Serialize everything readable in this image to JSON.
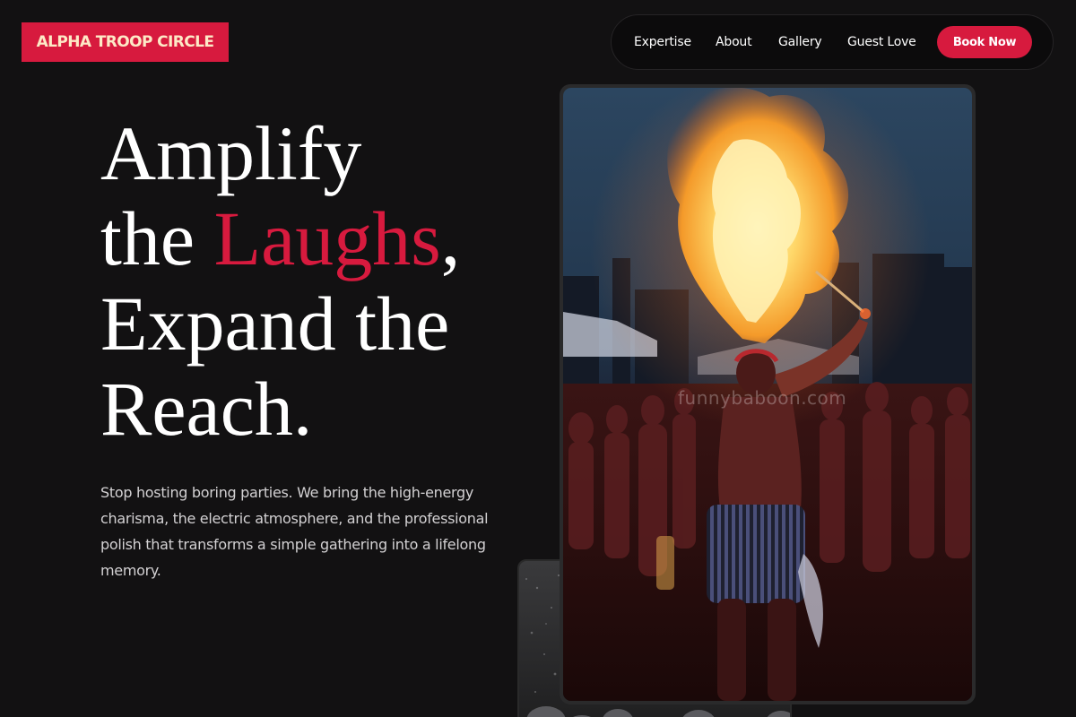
{
  "brand": {
    "logo_text": "ALPHA TROOP CIRCLE"
  },
  "nav": {
    "links": [
      {
        "label": "Expertise"
      },
      {
        "label": "About"
      },
      {
        "label": "Gallery"
      },
      {
        "label": "Guest Love"
      }
    ],
    "cta_label": "Book Now"
  },
  "hero": {
    "headline_part1": "Amplify",
    "headline_part2": "the ",
    "headline_accent": "Laughs",
    "headline_part3": ",",
    "headline_part4": "Expand the",
    "headline_part5": "Reach.",
    "subcopy": "Stop hosting boring parties. We bring the high-energy charisma, the electric atmosphere, and the professional polish that transforms a simple gathering into a lifelong memory."
  },
  "photo": {
    "watermark": "funnybaboon.com",
    "subject": "fire-breather-performer-photo"
  },
  "colors": {
    "accent": "#d71a3e",
    "background": "#121112",
    "logo_text": "#fde9c6"
  }
}
